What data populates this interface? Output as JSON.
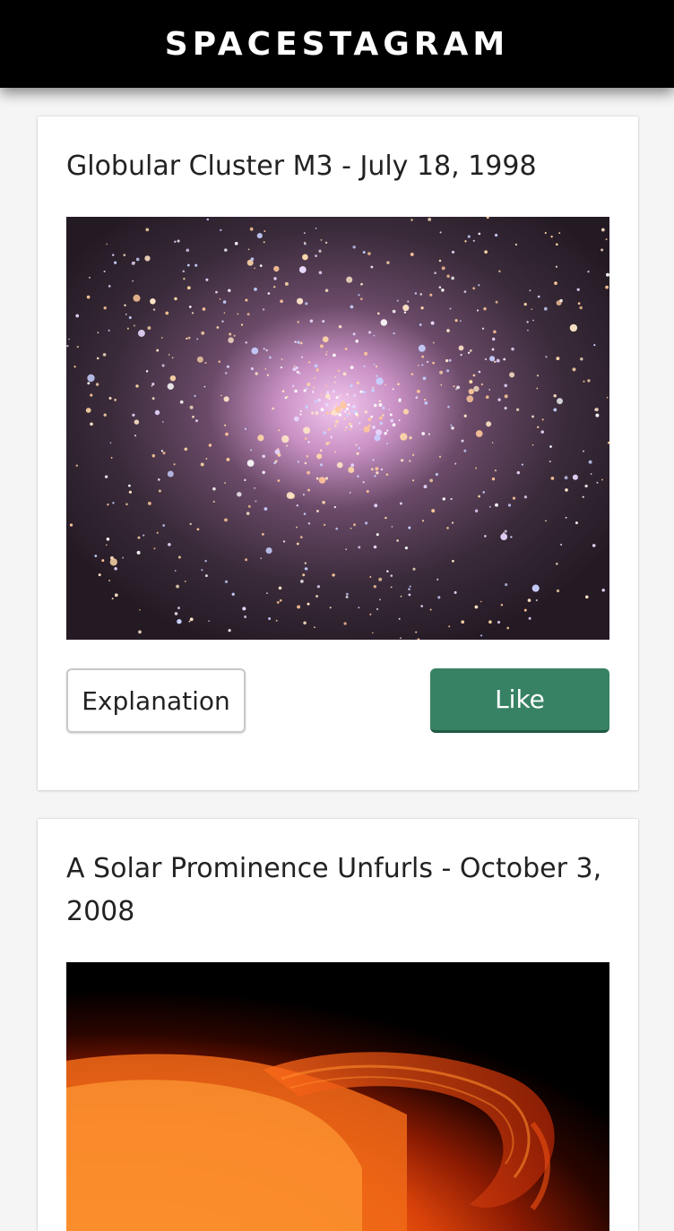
{
  "header": {
    "logo_text": "SPACESTAGRAM"
  },
  "posts": [
    {
      "title": "Globular Cluster M3 - July 18, 1998",
      "image_alt": "Globular Cluster M3",
      "explanation_label": "Explanation",
      "like_label": "Like"
    },
    {
      "title": "A Solar Prominence Unfurls - October 3, 2008",
      "image_alt": "A Solar Prominence Unfurls"
    }
  ],
  "colors": {
    "header_bg": "#000000",
    "like_button": "#378264",
    "page_bg": "#f5f5f5"
  }
}
